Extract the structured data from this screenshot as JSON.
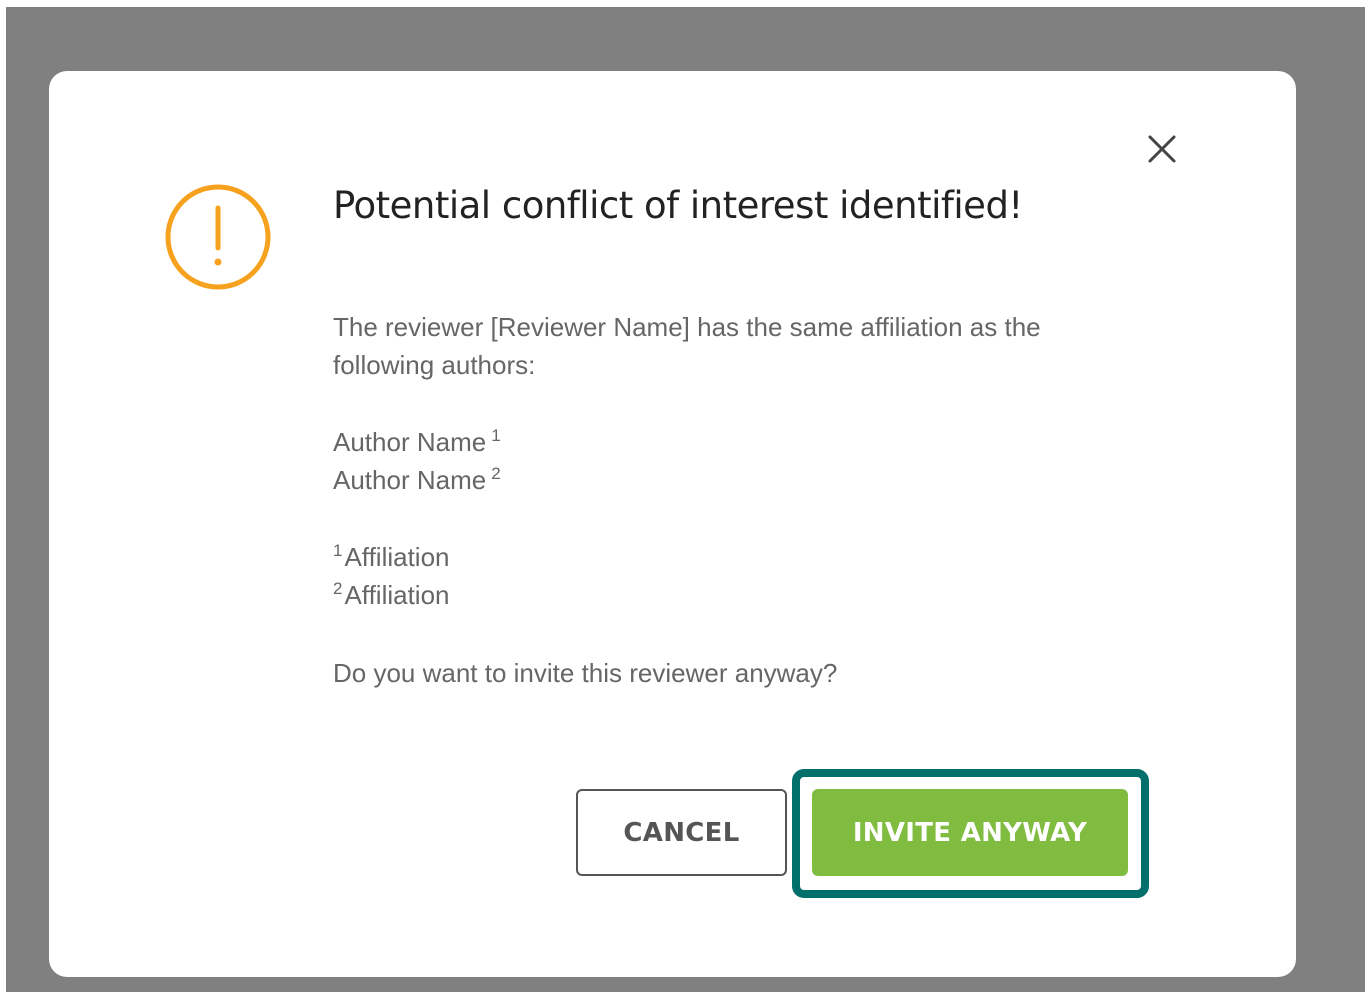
{
  "dialog": {
    "title": "Potential conflict of interest identified!",
    "message": "The reviewer [Reviewer Name] has the same affiliation as the following authors:",
    "authors": [
      {
        "name": "Author Name",
        "ref": "1"
      },
      {
        "name": "Author Name",
        "ref": "2"
      }
    ],
    "affiliations": [
      {
        "ref": "1",
        "name": "Affiliation"
      },
      {
        "ref": "2",
        "name": "Affiliation"
      }
    ],
    "question": "Do you want to invite this reviewer anyway?",
    "cancel_label": "CANCEL",
    "invite_label": "INVITE ANYWAY",
    "icons": {
      "warning": "exclamation-circle-icon",
      "close": "close-icon"
    }
  },
  "colors": {
    "overlay": "#808080",
    "warning": "#f7a21e",
    "invite_button": "#80bc40",
    "highlight_frame": "#016f6c",
    "title_text": "#222222",
    "body_text": "#666666"
  }
}
